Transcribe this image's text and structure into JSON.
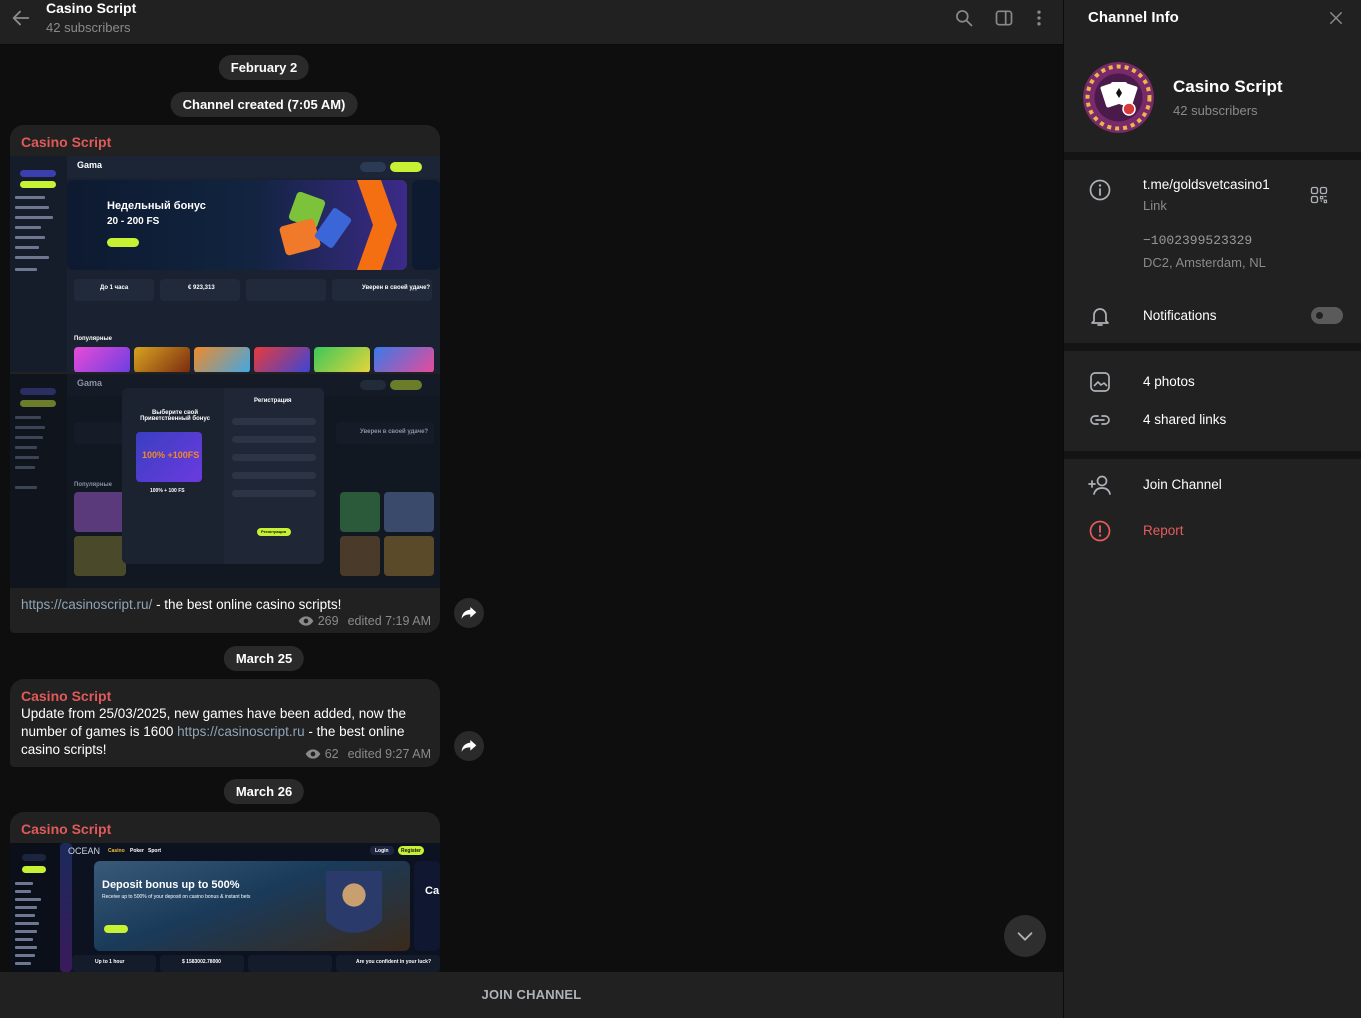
{
  "header": {
    "title": "Casino Script",
    "subtitle": "42 subscribers"
  },
  "dates": [
    "February 2",
    "March 25",
    "March 26"
  ],
  "service_message": "Channel created (7:05 AM)",
  "messages": [
    {
      "sender": "Casino Script",
      "text_link": "https://casinoscript.ru/",
      "text_rest": " - the best online casino scripts!",
      "views": "269",
      "time": "edited 7:19 AM",
      "screenshot_a": {
        "logo": "Gama",
        "bonus_title": "Недельный бонус",
        "bonus_sub": "20 - 200 FS",
        "stat_1": "До 1 часа",
        "stat_2": "€ 923,313",
        "stat_4": "Уверен в своей удаче?",
        "popular": "Популярные"
      },
      "screenshot_b": {
        "logo": "Gama",
        "modal_left_title": "Выберите свой Приветственный бонус",
        "modal_promo": "100% +100FS",
        "modal_promo_sub": "100% + 100 FS",
        "modal_right_title": "Регистрация",
        "modal_button": "Регистрация",
        "stat_4": "Уверен в своей удаче?",
        "popular": "Популярные"
      }
    },
    {
      "sender": "Casino Script",
      "text_1": "Update from 25/03/2025, new games have been added, now the number of games is 1600 ",
      "text_link": "https://casinoscript.ru",
      "text_2": "  - the best online casino scripts!",
      "views": "62",
      "time": "edited 9:27 AM"
    },
    {
      "sender": "Casino Script",
      "screenshot_c": {
        "logo": "OCEAN",
        "nav_1": "Casino",
        "nav_2": "Poker",
        "nav_3": "Sport",
        "login": "Login",
        "register": "Register",
        "bonus_title": "Deposit bonus up to 500%",
        "bonus_sub": "Receive up to 500% of your deposit on casino bonus & instant bets",
        "stat_1": "Up to 1 hour",
        "stat_2": "$ 1583002.78000",
        "stat_4": "Are you confident in your luck?"
      }
    }
  ],
  "join_bar": "JOIN CHANNEL",
  "info_panel": {
    "title": "Channel Info",
    "name": "Casino Script",
    "subscribers": "42 subscribers",
    "link": "t.me/goldsvetcasino1",
    "link_label": "Link",
    "id": "−1002399523329",
    "dc": "DC2, Amsterdam, NL",
    "notifications": "Notifications",
    "notifications_on": false,
    "photos": "4 photos",
    "shared_links": "4 shared links",
    "join": "Join Channel",
    "report": "Report"
  },
  "colors": {
    "accent_sender": "#e05a5a",
    "bubble": "#212121",
    "background": "#0e0e0e",
    "link": "#8fa4b8",
    "report": "#e55c5c"
  },
  "icons": [
    "back-arrow-icon",
    "search-icon",
    "sidebar-toggle-icon",
    "more-vertical-icon",
    "eye-icon",
    "share-icon",
    "chevron-down-icon",
    "close-icon",
    "info-icon",
    "qr-code-icon",
    "bell-icon",
    "photo-icon",
    "link-icon",
    "add-user-icon",
    "report-icon"
  ]
}
